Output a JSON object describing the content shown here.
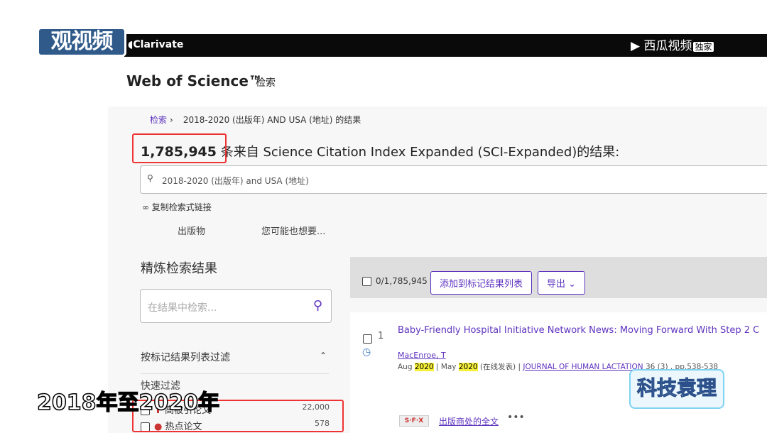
{
  "overlay": {
    "channel_logo": "观视频",
    "clarivate": "Clarivate",
    "xigua": "西瓜视频",
    "exclusive": "独家",
    "subtitle": "2018年至2020年",
    "watermark": "科技袁理"
  },
  "header": {
    "brand": "Web of Science™",
    "search_link": "检索"
  },
  "breadcrumb": {
    "root": "检索",
    "current": "2018-2020 (出版年) AND USA (地址) 的结果"
  },
  "results": {
    "count": "1,785,945",
    "count_suffix": "条来自 Science Citation Index Expanded (SCI-Expanded)的结果:"
  },
  "query": {
    "icon": "search-icon",
    "text": "2018-2020 (出版年) and USA (地址)"
  },
  "copy_link": "∞ 复制检索式链接",
  "tabs": [
    "出版物",
    "您可能也想要..."
  ],
  "refine": {
    "title": "精炼检索结果",
    "placeholder": "在结果中检索...",
    "mark_filter": "按标记结果列表过滤",
    "quick_filter": "快速过滤",
    "filters": [
      {
        "label": "高被引论文",
        "count": "22,000"
      },
      {
        "label": "热点论文",
        "count": "578"
      }
    ]
  },
  "toolbar": {
    "selected": "0/1,785,945",
    "add_label": "添加到标记结果列表",
    "export_label": "导出"
  },
  "record": {
    "num": "1",
    "title": "Baby-Friendly Hospital Initiative Network News: Moving Forward With Step 2 C",
    "author": "MacEnroe, T",
    "month1": "Aug",
    "year1": "2020",
    "month2": "May",
    "year2": "2020",
    "online": "(在线发表)",
    "journal": "JOURNAL OF HUMAN LACTATION",
    "pages": "36 (3) , pp.538-538",
    "sfx": "S·F·X",
    "fulltext": "出版商处的全文",
    "more": "•••"
  },
  "colors": {
    "accent": "#5e33bf",
    "highlight": "#e33"
  }
}
